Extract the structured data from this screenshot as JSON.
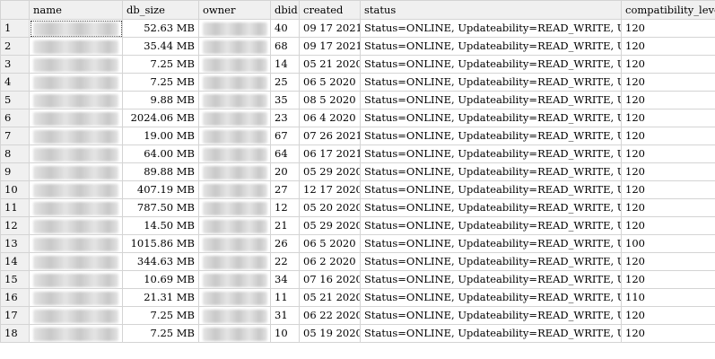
{
  "columns": [
    "name",
    "db_size",
    "owner",
    "dbid",
    "created",
    "status",
    "compatibility_level"
  ],
  "rows": [
    {
      "n": "1",
      "size": "52.63 MB",
      "dbid": "40",
      "created": "09 17 2021",
      "status": "Status=ONLINE, Updateability=READ_WRITE, UserAcc...",
      "compat": "120"
    },
    {
      "n": "2",
      "size": "35.44 MB",
      "dbid": "68",
      "created": "09 17 2021",
      "status": "Status=ONLINE, Updateability=READ_WRITE, UserAcc...",
      "compat": "120"
    },
    {
      "n": "3",
      "size": "7.25 MB",
      "dbid": "14",
      "created": "05 21 2020",
      "status": "Status=ONLINE, Updateability=READ_WRITE, UserAcc...",
      "compat": "120"
    },
    {
      "n": "4",
      "size": "7.25 MB",
      "dbid": "25",
      "created": "06  5 2020",
      "status": "Status=ONLINE, Updateability=READ_WRITE, UserAcc...",
      "compat": "120"
    },
    {
      "n": "5",
      "size": "9.88 MB",
      "dbid": "35",
      "created": "08  5 2020",
      "status": "Status=ONLINE, Updateability=READ_WRITE, UserAcc...",
      "compat": "120"
    },
    {
      "n": "6",
      "size": "2024.06 MB",
      "dbid": "23",
      "created": "06  4 2020",
      "status": "Status=ONLINE, Updateability=READ_WRITE, UserAcc...",
      "compat": "120"
    },
    {
      "n": "7",
      "size": "19.00 MB",
      "dbid": "67",
      "created": "07 26 2021",
      "status": "Status=ONLINE, Updateability=READ_WRITE, UserAcc...",
      "compat": "120"
    },
    {
      "n": "8",
      "size": "64.00 MB",
      "dbid": "64",
      "created": "06 17 2021",
      "status": "Status=ONLINE, Updateability=READ_WRITE, UserAcc...",
      "compat": "120"
    },
    {
      "n": "9",
      "size": "89.88 MB",
      "dbid": "20",
      "created": "05 29 2020",
      "status": "Status=ONLINE, Updateability=READ_WRITE, UserAcc...",
      "compat": "120"
    },
    {
      "n": "10",
      "size": "407.19 MB",
      "dbid": "27",
      "created": "12 17 2020",
      "status": "Status=ONLINE, Updateability=READ_WRITE, UserAcc...",
      "compat": "120"
    },
    {
      "n": "11",
      "size": "787.50 MB",
      "dbid": "12",
      "created": "05 20 2020",
      "status": "Status=ONLINE, Updateability=READ_WRITE, UserAcc...",
      "compat": "120"
    },
    {
      "n": "12",
      "size": "14.50 MB",
      "dbid": "21",
      "created": "05 29 2020",
      "status": "Status=ONLINE, Updateability=READ_WRITE, UserAcc...",
      "compat": "120"
    },
    {
      "n": "13",
      "size": "1015.86 MB",
      "dbid": "26",
      "created": "06  5 2020",
      "status": "Status=ONLINE, Updateability=READ_WRITE, UserAcc...",
      "compat": "100"
    },
    {
      "n": "14",
      "size": "344.63 MB",
      "dbid": "22",
      "created": "06  2 2020",
      "status": "Status=ONLINE, Updateability=READ_WRITE, UserAcc...",
      "compat": "120"
    },
    {
      "n": "15",
      "size": "10.69 MB",
      "dbid": "34",
      "created": "07 16 2020",
      "status": "Status=ONLINE, Updateability=READ_WRITE, UserAcc...",
      "compat": "120"
    },
    {
      "n": "16",
      "size": "21.31 MB",
      "dbid": "11",
      "created": "05 21 2020",
      "status": "Status=ONLINE, Updateability=READ_WRITE, UserAcc...",
      "compat": "110"
    },
    {
      "n": "17",
      "size": "7.25 MB",
      "dbid": "31",
      "created": "06 22 2020",
      "status": "Status=ONLINE, Updateability=READ_WRITE, UserAcc...",
      "compat": "120"
    },
    {
      "n": "18",
      "size": "7.25 MB",
      "dbid": "10",
      "created": "05 19 2020",
      "status": "Status=ONLINE, Updateability=READ_WRITE, UserAcc...",
      "compat": "120"
    }
  ],
  "colors": {
    "header_bg": "#f0f0f0",
    "grid_line": "#d4d4d4",
    "redacted_dark": "#c8c8c8",
    "redacted_light": "#e4e4e4"
  }
}
